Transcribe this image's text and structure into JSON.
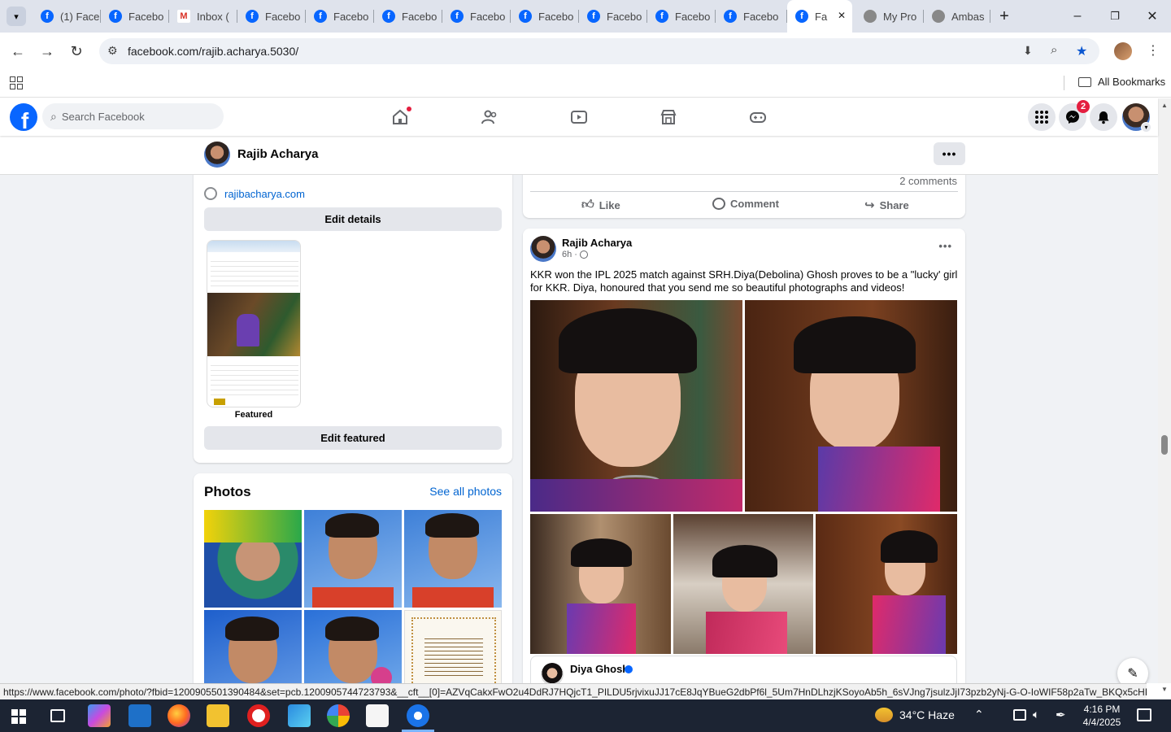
{
  "browser": {
    "tabs": [
      {
        "label": "(1) Face",
        "icon": "facebook-icon"
      },
      {
        "label": "Facebo",
        "icon": "facebook-icon"
      },
      {
        "label": "Inbox (",
        "icon": "gmail-icon"
      },
      {
        "label": "Facebo",
        "icon": "facebook-icon"
      },
      {
        "label": "Facebo",
        "icon": "facebook-icon"
      },
      {
        "label": "Facebo",
        "icon": "facebook-icon"
      },
      {
        "label": "Facebo",
        "icon": "facebook-icon"
      },
      {
        "label": "Facebo",
        "icon": "facebook-icon"
      },
      {
        "label": "Facebo",
        "icon": "facebook-icon"
      },
      {
        "label": "Facebo",
        "icon": "facebook-icon"
      },
      {
        "label": "Facebo",
        "icon": "facebook-icon"
      },
      {
        "label": "Fa",
        "icon": "facebook-icon",
        "active": true
      },
      {
        "label": "My Pro",
        "icon": "globe-icon"
      },
      {
        "label": "Ambas",
        "icon": "globe-icon"
      }
    ],
    "url": "facebook.com/rajib.acharya.5030/",
    "bookmarks_label": "All Bookmarks",
    "status_url": "https://www.facebook.com/photo/?fbid=1200905501390484&set=pcb.1200905744723793&__cft__[0]=AZVqCakxFwO2u4DdRJ7HQjcT1_PILDU5rjvixuJJ17cE8JqYBueG2dbPf6l_5Um7HnDLhzjKSoyoAb5h_6sVJng7jsulzJjI73pzb2yNj-G-O-IoWIF58p2aTw_BKQx5cHKvIG9..."
  },
  "facebook": {
    "search_placeholder": "Search Facebook",
    "messenger_badge": "2",
    "profile_name": "Rajib Acharya",
    "intro": {
      "website": "rajibacharya.com",
      "edit_details": "Edit details",
      "featured_label": "Featured",
      "edit_featured": "Edit featured"
    },
    "photos": {
      "title": "Photos",
      "see_all": "See all photos"
    },
    "prev_post": {
      "comments": "2 comments",
      "like": "Like",
      "comment": "Comment",
      "share": "Share"
    },
    "post": {
      "author": "Rajib Acharya",
      "time": "6h",
      "time_sep": "·",
      "text": "KKR won the IPL 2025 match against SRH.Diya(Debolina) Ghosh proves to be a \"lucky' girl for KKR. Diya, honoured that you send me so beautiful photographs and videos!",
      "shared_author": "Diya Ghosh"
    }
  },
  "taskbar": {
    "weather": "34°C  Haze",
    "time": "4:16 PM",
    "date": "4/4/2025"
  },
  "colors": {
    "fb_blue": "#0866ff",
    "fb_gray": "#f0f2f5",
    "link_blue": "#0064d1",
    "tabbar": "#dfe3ec"
  }
}
